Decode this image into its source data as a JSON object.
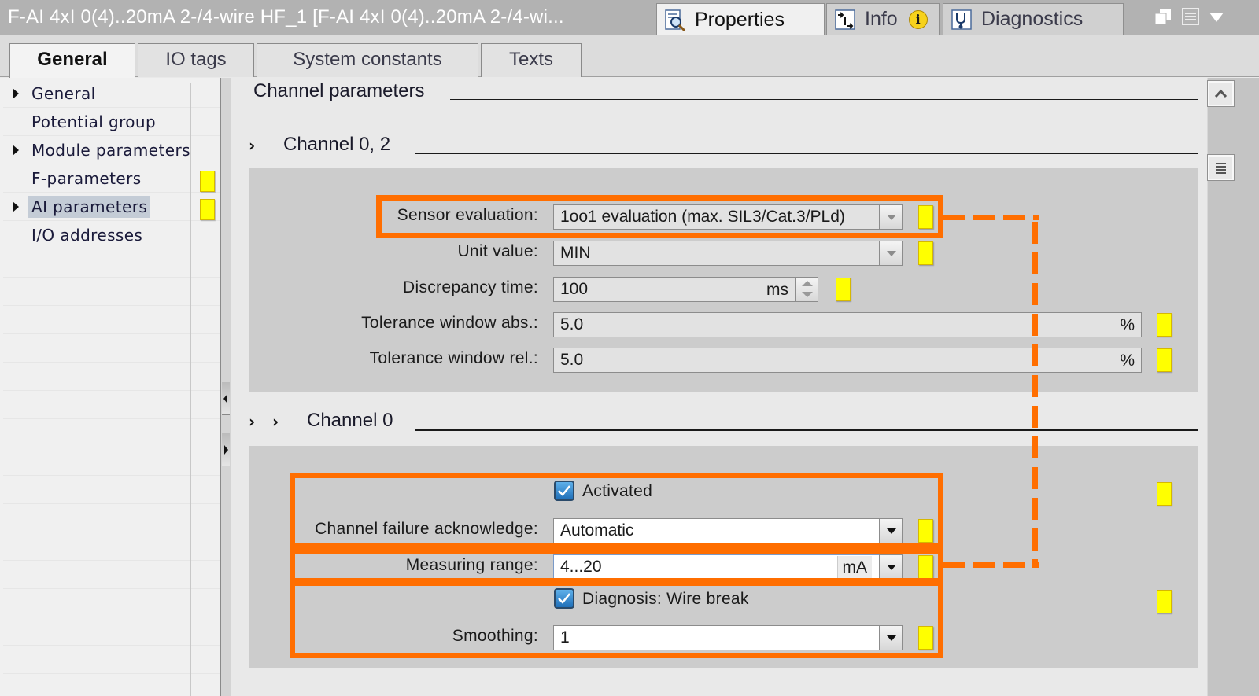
{
  "window": {
    "title": "F-AI 4xI 0(4)..20mA 2-/4-wire HF_1 [F-AI 4xI 0(4)..20mA 2-/4-wi..."
  },
  "top_tabs": [
    {
      "label": "Properties",
      "icon": "properties-icon",
      "active": true
    },
    {
      "label": "Info",
      "icon": "info-icon",
      "active": false,
      "badge": "i"
    },
    {
      "label": "Diagnostics",
      "icon": "diagnostics-icon",
      "active": false
    }
  ],
  "window_controls": [
    "restore-icon",
    "list-icon",
    "dropdown-icon"
  ],
  "sub_tabs": [
    {
      "label": "General",
      "active": true
    },
    {
      "label": "IO tags",
      "active": false
    },
    {
      "label": "System constants",
      "active": false
    },
    {
      "label": "Texts",
      "active": false
    }
  ],
  "nav": {
    "items": [
      {
        "label": "General",
        "expandable": true,
        "flag": false,
        "selected": false
      },
      {
        "label": "Potential group",
        "expandable": false,
        "flag": false,
        "selected": false
      },
      {
        "label": "Module parameters",
        "expandable": true,
        "flag": false,
        "selected": false
      },
      {
        "label": "F-parameters",
        "expandable": false,
        "flag": true,
        "selected": false
      },
      {
        "label": "AI parameters",
        "expandable": true,
        "flag": true,
        "selected": true
      },
      {
        "label": "I/O addresses",
        "expandable": false,
        "flag": false,
        "selected": false
      }
    ]
  },
  "content": {
    "heading": "Channel parameters",
    "channel_group": {
      "title": "Channel 0, 2",
      "fields": {
        "sensor_evaluation": {
          "label": "Sensor evaluation:",
          "value": "1oo1 evaluation (max. SIL3/Cat.3/PLd)"
        },
        "unit_value": {
          "label": "Unit value:",
          "value": "MIN"
        },
        "discrepancy_time": {
          "label": "Discrepancy time:",
          "value": "100",
          "unit": "ms"
        },
        "tolerance_abs": {
          "label": "Tolerance window abs.:",
          "value": "5.0",
          "unit": "%"
        },
        "tolerance_rel": {
          "label": "Tolerance window rel.:",
          "value": "5.0",
          "unit": "%"
        }
      }
    },
    "channel_0": {
      "title": "Channel 0",
      "activated": {
        "label": "Activated",
        "checked": true
      },
      "channel_failure_ack": {
        "label": "Channel failure acknowledge:",
        "value": "Automatic"
      },
      "measuring_range": {
        "label": "Measuring range:",
        "value": "4...20",
        "unit": "mA"
      },
      "diagnosis_wire_break": {
        "label": "Diagnosis: Wire break",
        "checked": true
      },
      "smoothing": {
        "label": "Smoothing:",
        "value": "1"
      }
    }
  },
  "colors": {
    "highlight": "#ff6e00",
    "flag": "#ffff00",
    "panel": "#cccccc",
    "checkbox": "#1f6fb8"
  }
}
